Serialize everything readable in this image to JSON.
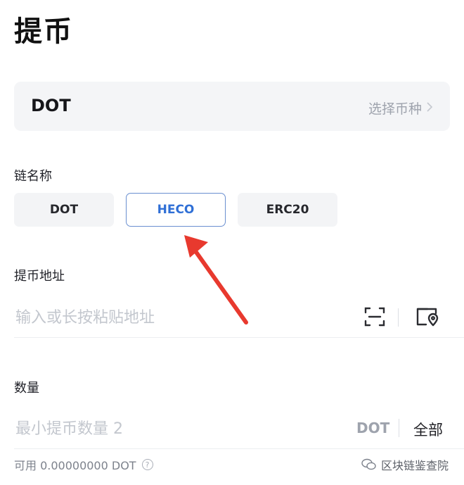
{
  "page": {
    "title": "提币"
  },
  "coin": {
    "name": "DOT",
    "select_label": "选择币种"
  },
  "chain": {
    "label": "链名称",
    "options": [
      "DOT",
      "HECO",
      "ERC20"
    ],
    "selected": "HECO"
  },
  "address": {
    "label": "提币地址",
    "placeholder": "输入或长按粘贴地址"
  },
  "amount": {
    "label": "数量",
    "placeholder": "最小提币数量 2",
    "unit": "DOT",
    "all_label": "全部",
    "available": "可用 0.00000000 DOT"
  },
  "watermark": {
    "text": "区块链鉴查院"
  },
  "colors": {
    "accent": "#2f6fd6",
    "arrow": "#e8392e"
  },
  "icons": [
    "chevron-right-icon",
    "scan-icon",
    "address-book-icon",
    "help-icon",
    "wechat-icon"
  ]
}
